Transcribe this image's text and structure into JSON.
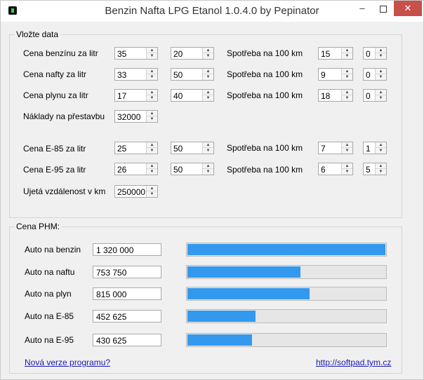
{
  "window": {
    "title": "Benzin Nafta LPG Etanol 1.0.4.0 by Pepinator",
    "minimize_glyph": "–",
    "close_glyph": "✕"
  },
  "inputs_group": {
    "title": "Vložte data",
    "rows": [
      {
        "label": "Cena benzínu za litr",
        "price": "35",
        "price2": "20",
        "consumption_label": "Spotřeba na 100 km",
        "cons1": "15",
        "cons2": "0"
      },
      {
        "label": "Cena nafty za litr",
        "price": "33",
        "price2": "50",
        "consumption_label": "Spotřeba na 100 km",
        "cons1": "9",
        "cons2": "0"
      },
      {
        "label": "Cena plynu  za litr",
        "price": "17",
        "price2": "40",
        "consumption_label": "Spotřeba na 100 km",
        "cons1": "18",
        "cons2": "0"
      },
      {
        "label": "Cena E-85 za litr",
        "price": "25",
        "price2": "50",
        "consumption_label": "Spotřeba na 100 km",
        "cons1": "7",
        "cons2": "1"
      },
      {
        "label": "Cena E-95 za litr",
        "price": "26",
        "price2": "50",
        "consumption_label": "Spotřeba na 100 km",
        "cons1": "6",
        "cons2": "5"
      }
    ],
    "conversion": {
      "label": "Náklady na přestavbu",
      "value": "32000"
    },
    "distance": {
      "label": "Ujetá vzdálenost v km",
      "value": "250000"
    }
  },
  "results_group": {
    "title": "Cena PHM:",
    "rows": [
      {
        "label": "Auto na benzin",
        "value": "1 320 000",
        "fraction": 1.0
      },
      {
        "label": "Auto na naftu",
        "value": "753 750",
        "fraction": 0.571
      },
      {
        "label": "Auto na plyn",
        "value": "815 000",
        "fraction": 0.617
      },
      {
        "label": "Auto na E-85",
        "value": "452 625",
        "fraction": 0.343
      },
      {
        "label": "Auto na E-95",
        "value": "430 625",
        "fraction": 0.326
      }
    ],
    "bar_color": "#3399ee"
  },
  "footer": {
    "new_version_link": "Nová verze programu?",
    "website_link": "http://softpad.tym.cz"
  }
}
